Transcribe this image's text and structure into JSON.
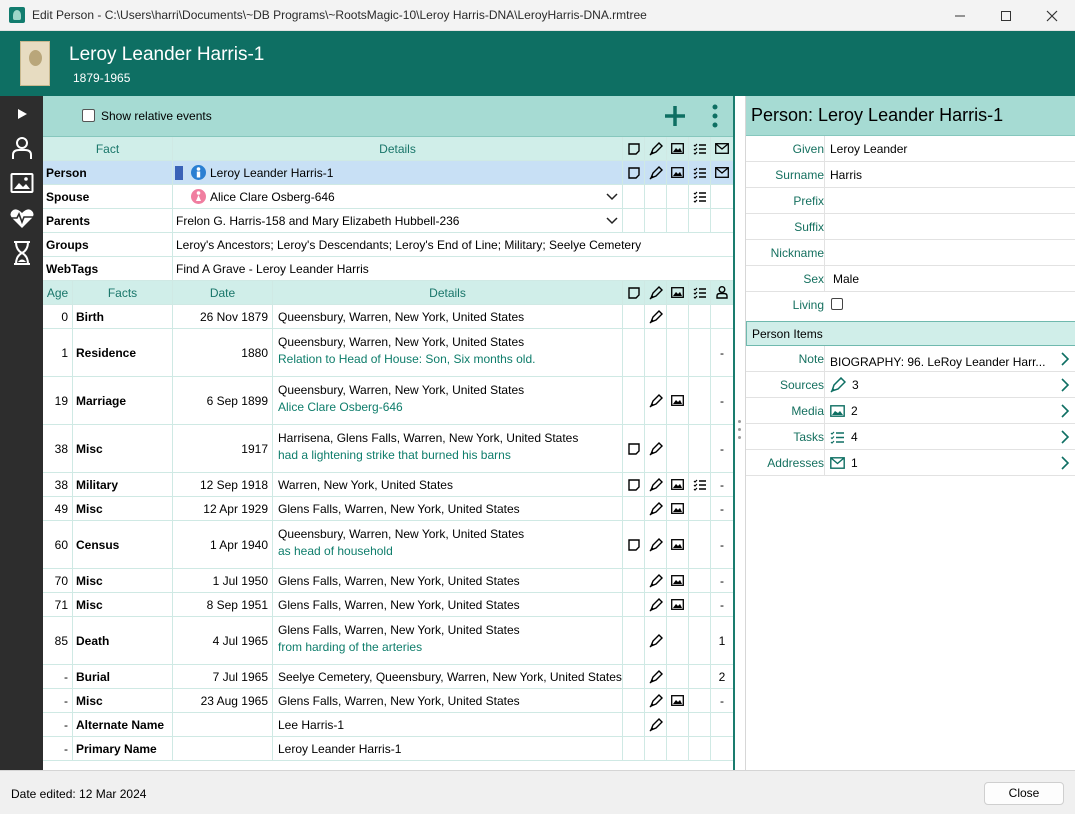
{
  "window": {
    "title": "Edit Person - C:\\Users\\harri\\Documents\\~DB Programs\\~RootsMagic-10\\Leroy Harris-DNA\\LeroyHarris-DNA.rmtree",
    "controls": [
      "minimize",
      "maximize",
      "close"
    ]
  },
  "header": {
    "name": "Leroy Leander Harris-1",
    "dates": "1879-1965"
  },
  "sidebar": {
    "items": [
      "expand-arrow-icon",
      "person-icon",
      "media-icon",
      "health-icon",
      "timeline-icon"
    ]
  },
  "toolbar": {
    "show_relative_events": "Show relative events",
    "show_relative_events_checked": false
  },
  "facts_table": {
    "header": {
      "fact": "Fact",
      "details": "Details"
    },
    "rows": [
      {
        "fact": "Person",
        "details": "Leroy Leander Harris-1",
        "selected": true
      },
      {
        "fact": "Spouse",
        "details": "Alice Clare Osberg-646"
      },
      {
        "fact": "Parents",
        "details": "Frelon G. Harris-158 and Mary Elizabeth Hubbell-236"
      },
      {
        "fact": "Groups",
        "details": "Leroy's Ancestors; Leroy's Descendants; Leroy's End of Line; Military; Seelye Cemetery"
      },
      {
        "fact": "WebTags",
        "details": "Find A Grave - Leroy Leander Harris"
      }
    ]
  },
  "events_table": {
    "header": {
      "age": "Age",
      "facts": "Facts",
      "date": "Date",
      "details": "Details"
    },
    "rows": [
      {
        "age": "0",
        "fact": "Birth",
        "date": "26 Nov 1879",
        "place": "Queensbury, Warren, New York, United States",
        "desc": "",
        "count": ""
      },
      {
        "age": "1",
        "fact": "Residence",
        "date": "1880",
        "place": "Queensbury, Warren, New York, United States",
        "desc": "Relation to Head of House: Son, Six months old.",
        "count": "-"
      },
      {
        "age": "19",
        "fact": "Marriage",
        "date": "6 Sep 1899",
        "place": "Queensbury, Warren, New York, United States",
        "desc": "Alice Clare Osberg-646",
        "count": "-"
      },
      {
        "age": "38",
        "fact": "Misc",
        "date": "1917",
        "place": "Harrisena, Glens Falls, Warren, New York, United States",
        "desc": "had a  lightening strike that burned his barns",
        "count": "-"
      },
      {
        "age": "38",
        "fact": "Military",
        "date": "12 Sep 1918",
        "place": "Warren, New York, United States",
        "desc": "",
        "count": "-"
      },
      {
        "age": "49",
        "fact": "Misc",
        "date": "12 Apr 1929",
        "place": "Glens Falls, Warren, New York, United States",
        "desc": "",
        "count": "-"
      },
      {
        "age": "60",
        "fact": "Census",
        "date": "1 Apr 1940",
        "place": "Queensbury, Warren, New York, United States",
        "desc": "as head of household",
        "count": "-"
      },
      {
        "age": "70",
        "fact": "Misc",
        "date": "1 Jul 1950",
        "place": "Glens Falls, Warren, New York, United States",
        "desc": "",
        "count": "-"
      },
      {
        "age": "71",
        "fact": "Misc",
        "date": "8 Sep 1951",
        "place": "Glens Falls, Warren, New York, United States",
        "desc": "",
        "count": "-"
      },
      {
        "age": "85",
        "fact": "Death",
        "date": "4 Jul 1965",
        "place": "Glens Falls, Warren, New York, United States",
        "desc": "from harding of the arteries",
        "count": "1"
      },
      {
        "age": "-",
        "fact": "Burial",
        "date": "7 Jul 1965",
        "place": "Seelye Cemetery, Queensbury, Warren, New York, United States",
        "desc": "",
        "count": "2"
      },
      {
        "age": "-",
        "fact": "Misc",
        "date": "23 Aug 1965",
        "place": "Glens Falls, Warren, New York, United States",
        "desc": "",
        "count": "-"
      },
      {
        "age": "-",
        "fact": "Alternate Name",
        "date": "",
        "place": "Lee Harris-1",
        "desc": "",
        "count": ""
      },
      {
        "age": "-",
        "fact": "Primary Name",
        "date": "",
        "place": "Leroy Leander Harris-1",
        "desc": "",
        "count": ""
      }
    ]
  },
  "person_panel": {
    "title": "Person: Leroy Leander Harris-1",
    "fields": {
      "given_label": "Given",
      "given": "Leroy Leander",
      "surname_label": "Surname",
      "surname": "Harris",
      "prefix_label": "Prefix",
      "prefix": "",
      "suffix_label": "Suffix",
      "suffix": "",
      "nickname_label": "Nickname",
      "nickname": "",
      "sex_label": "Sex",
      "sex": "Male",
      "living_label": "Living",
      "living": false
    },
    "items_header": "Person Items",
    "items": {
      "note_label": "Note",
      "note": "BIOGRAPHY:      96.  LeRoy Leander Harr...",
      "sources_label": "Sources",
      "sources": "3",
      "media_label": "Media",
      "media": "2",
      "tasks_label": "Tasks",
      "tasks": "4",
      "addresses_label": "Addresses",
      "addresses": "1"
    }
  },
  "footer": {
    "date_edited": "Date edited: 12 Mar 2024",
    "close": "Close"
  },
  "colors": {
    "header_bg": "#0e6f63",
    "toolbar_bg": "#a6dbd3",
    "table_header_bg": "#d0eee9",
    "selected_row": "#c8e0f5",
    "accent_text": "#0e7d6b",
    "sidebar_bg": "#2d2d2d"
  }
}
